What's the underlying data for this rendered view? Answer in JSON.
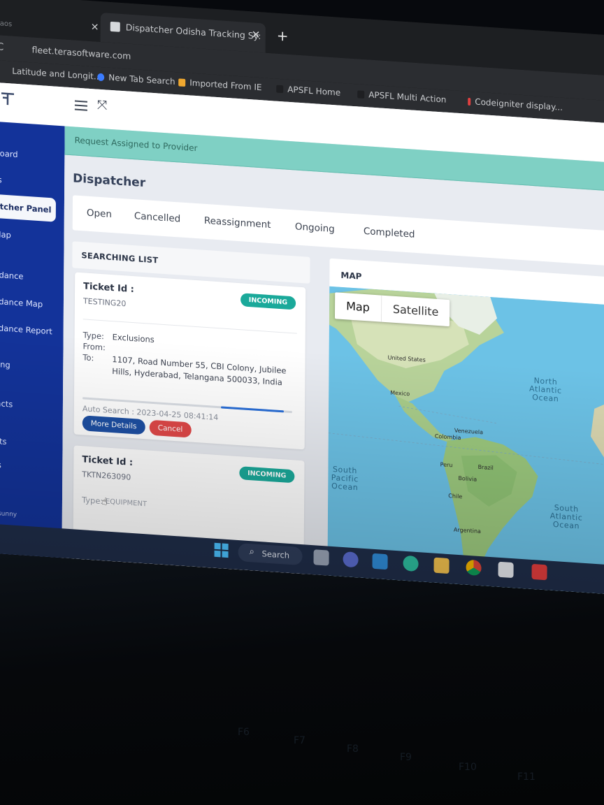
{
  "browser": {
    "prev_tab_fragment": "aos",
    "active_tab_title": "Dispatcher Odisha Tracking Sy:",
    "url": "fleet.terasoftware.com",
    "bookmarks": [
      "Latitude and Longit...",
      "New Tab Search",
      "Imported From IE",
      "APSFL Home",
      "APSFL Multi Action",
      "Codeigniter display..."
    ]
  },
  "app": {
    "logo_text": "TERASOFT",
    "sidebar": [
      {
        "label": "board"
      },
      {
        "label": "ts"
      },
      {
        "label": "atcher Panel",
        "active": true
      },
      {
        "label": "Map"
      },
      {
        "label": "ndance"
      },
      {
        "label": "ndance Map"
      },
      {
        "label": "ndance Report"
      },
      {
        "label": "king"
      },
      {
        "label": "tacts"
      },
      {
        "label": "icts"
      },
      {
        "label": "ks"
      },
      {
        "label": "s"
      },
      {
        "label": "y sunny"
      }
    ],
    "alert": "Request Assigned to Provider",
    "page_title": "Dispatcher",
    "status_tabs": [
      "Open",
      "Cancelled",
      "Reassignment",
      "Ongoing",
      "Completed"
    ],
    "search_list": {
      "heading": "SEARCHING LIST",
      "tickets": [
        {
          "label": "Ticket Id :",
          "id": "TESTING20",
          "badge": "INCOMING",
          "type_key": "Type:",
          "type_val": "Exclusions",
          "from_key": "From:",
          "from_val": "",
          "to_key": "To:",
          "to_val": "1107, Road Number 55, CBI Colony, Jubilee Hills, Hyderabad, Telangana 500033, India",
          "progress": 0.3,
          "auto_search": "Auto Search : 2023-04-25 08:41:14",
          "more_label": "More Details",
          "cancel_label": "Cancel"
        },
        {
          "label": "Ticket Id :",
          "id": "TKTN263090",
          "badge": "INCOMING",
          "type_key": "Type:",
          "type_val": "EQUIPMENT"
        }
      ]
    },
    "map": {
      "heading": "MAP",
      "toggle": [
        "Map",
        "Satellite"
      ],
      "places": [
        "United States",
        "Mexico",
        "Venezuela",
        "Colombia",
        "Peru",
        "Brazil",
        "Bolivia",
        "Chile",
        "Argentina"
      ],
      "oceans": [
        "North Atlantic Ocean",
        "South Pacific Ocean",
        "South Atlantic Ocean"
      ]
    }
  },
  "taskbar": {
    "search_label": "Search"
  }
}
